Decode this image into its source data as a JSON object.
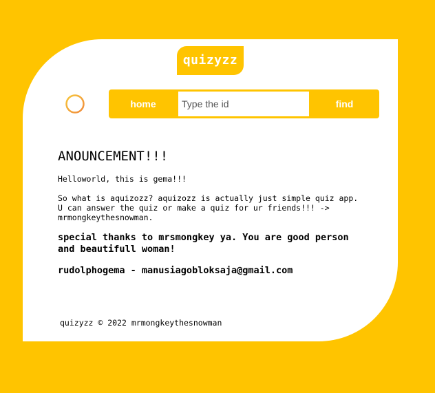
{
  "header": {
    "logo_text": "quizyzz"
  },
  "nav": {
    "add_icon": "plus-circle-icon",
    "home_label": "home",
    "search_placeholder": "Type the id",
    "search_value": "",
    "find_label": "find"
  },
  "announcement": {
    "title": "ANOUNCEMENT!!!",
    "greeting": "Helloworld, this is gema!!!",
    "description": "So what is aquizozz? aquizozz is actually just simple quiz app. U can answer the quiz or make a quiz for ur friends!!! -> mrmongkeythesnowman.",
    "thanks": "special thanks to mrsmongkey ya. You are good person and beautifull woman!",
    "contact": "rudolphogema - manusiagobloksaja@gmail.com"
  },
  "footer": {
    "text": "quizyzz © 2022 mrmongkeythesnowman"
  },
  "colors": {
    "background": "#FFC400",
    "card": "#FFFFFF",
    "accent_orange": "#F5A623"
  }
}
